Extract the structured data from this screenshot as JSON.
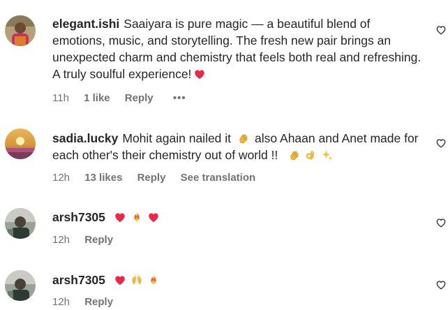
{
  "comments": [
    {
      "username": "elegant.ishi",
      "text": "Saaiyara is pure magic — a beautiful blend of emotions, music, and storytelling. The fresh new pair brings an unexpected charm and chemistry that feels both real and refreshing. A truly soulful experience!",
      "trailing_emojis": [
        "red-heart"
      ],
      "time": "11h",
      "likes": "1 like",
      "reply_label": "Reply",
      "more_label": "•••"
    },
    {
      "username": "sadia.lucky",
      "text_part1": "Mohit again nailed it",
      "text_part2": "also Ahaan and Anet made for each other's their chemistry out of world !!",
      "time": "12h",
      "likes": "13 likes",
      "reply_label": "Reply",
      "translate_label": "See translation"
    },
    {
      "username": "arsh7305",
      "emojis": [
        "red-heart",
        "fire",
        "red-heart"
      ],
      "time": "12h",
      "reply_label": "Reply"
    },
    {
      "username": "arsh7305",
      "emojis": [
        "red-heart",
        "raising-hands",
        "fire"
      ],
      "time": "12h",
      "reply_label": "Reply"
    }
  ],
  "colors": {
    "text": "#262626",
    "meta": "#737373",
    "heart": "#e8294b"
  }
}
